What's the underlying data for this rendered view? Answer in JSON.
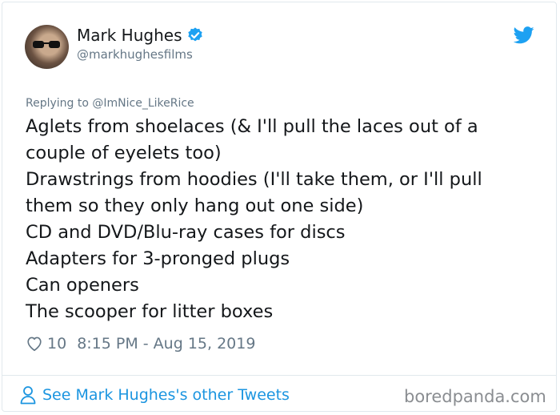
{
  "tweet": {
    "author_name": "Mark Hughes",
    "author_handle": "@markhughesfilms",
    "replying_prefix": "Replying to",
    "replying_to": "@ImNice_LikeRice",
    "lines": [
      "Aglets from shoelaces (& I'll pull the laces out of a",
      "couple of eyelets too)",
      "Drawstrings from hoodies (I'll take them, or I'll pull",
      "them so they only hang out one side)",
      "CD and DVD/Blu-ray cases for discs",
      "Adapters for 3-pronged plugs",
      "Can openers",
      "The scooper for litter boxes"
    ],
    "likes": "10",
    "timestamp": "8:15 PM - Aug 15, 2019"
  },
  "footer": {
    "see_more": "See Mark Hughes's other Tweets",
    "watermark": "boredpanda.com"
  },
  "icons": {
    "verified": "verified-badge-icon",
    "bird": "twitter-bird-icon",
    "heart": "heart-outline-icon",
    "person": "person-icon"
  },
  "colors": {
    "twitter_blue": "#1da1f2",
    "link_blue": "#1b95e0",
    "text": "#14171a",
    "muted": "#657786"
  }
}
